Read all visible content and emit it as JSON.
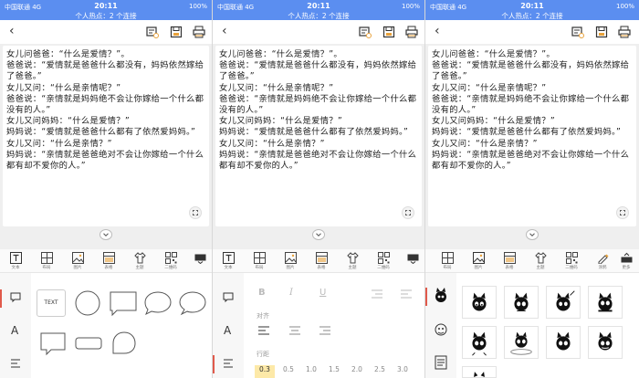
{
  "status": {
    "carrier": "中国联通  4G",
    "time": "20:11",
    "battery": "100%",
    "hotspot": "个人热点：2 个连接"
  },
  "story": [
    "女儿问爸爸：“什么是爱情？”。",
    "爸爸说：“爱情就是爸爸什么都没有，妈妈依然嫁给了爸爸。”",
    "女儿又问：“什么是亲情呢？”",
    "爸爸说：“亲情就是妈妈绝不会让你嫁给一个什么都没有的人。”",
    "女儿又问妈妈：“什么是爱情？”",
    "妈妈说：“爱情就是爸爸什么都有了依然爱妈妈。”",
    "女儿又问：“什么是亲情？”",
    "妈妈说：“亲情就是爸爸绝对不会让你嫁给一个什么都有却不爱你的人。”"
  ],
  "tabs": {
    "text": "文本",
    "layout": "布局",
    "image": "图片",
    "table": "表格",
    "theme": "主题",
    "qrcode": "二维码",
    "doodle": "涂鸦",
    "more": "更多"
  },
  "shapes": {
    "text_box_label": "TEXT"
  },
  "format": {
    "align_label": "对齐",
    "line_spacing_label": "行距",
    "line_spacing_options": [
      "0.3",
      "0.5",
      "1.0",
      "1.5",
      "2.0",
      "2.5",
      "3.0"
    ],
    "selected_line_spacing": "0.3"
  },
  "sidebar": {
    "font_label": "A"
  },
  "colors": {
    "status_bar": "#5b8ef0",
    "accent": "#e05a4b",
    "selected_chip": "#fde9a8"
  }
}
